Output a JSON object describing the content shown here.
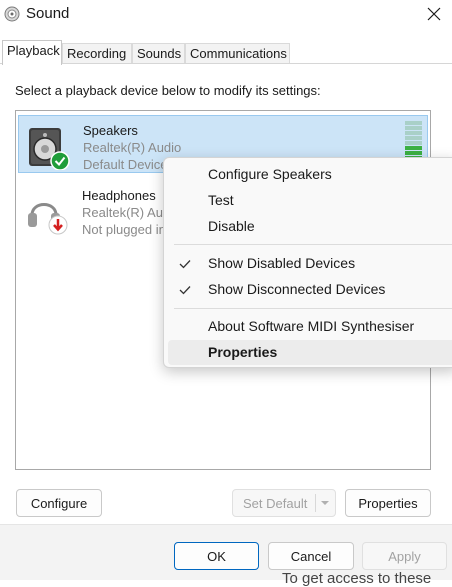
{
  "window": {
    "title": "Sound",
    "close_icon": "close-icon"
  },
  "tabs": [
    {
      "label": "Playback",
      "active": true
    },
    {
      "label": "Recording",
      "active": false
    },
    {
      "label": "Sounds",
      "active": false
    },
    {
      "label": "Communications",
      "active": false
    }
  ],
  "instruction": "Select a playback device below to modify its settings:",
  "devices": [
    {
      "name": "Speakers",
      "driver": "Realtek(R) Audio",
      "status": "Default Device",
      "icon": "speaker-icon",
      "badge": "green-check-icon",
      "selected": true,
      "level_segments_active": 4,
      "level_segments_total": 9
    },
    {
      "name": "Headphones",
      "driver": "Realtek(R) Audio",
      "status": "Not plugged in",
      "icon": "headphones-icon",
      "badge": "red-down-arrow-icon",
      "selected": false
    }
  ],
  "context_menu": {
    "items": [
      {
        "label": "Configure Speakers",
        "checked": false
      },
      {
        "label": "Test",
        "checked": false
      },
      {
        "label": "Disable",
        "checked": false
      },
      {
        "label": "Show Disabled Devices",
        "checked": true
      },
      {
        "label": "Show Disconnected Devices",
        "checked": true
      },
      {
        "label": "About Software MIDI Synthesiser",
        "checked": false
      },
      {
        "label": "Properties",
        "checked": false,
        "bold": true,
        "highlighted": true
      }
    ]
  },
  "buttons": {
    "configure": "Configure",
    "set_default": "Set Default",
    "properties": "Properties",
    "ok": "OK",
    "cancel": "Cancel",
    "apply": "Apply"
  },
  "background_text": "To get access to these",
  "colors": {
    "accent": "#0067c0",
    "selection": "#cce4f7",
    "meter_active": "#3cb043",
    "meter_inactive": "#a9d0c8"
  }
}
